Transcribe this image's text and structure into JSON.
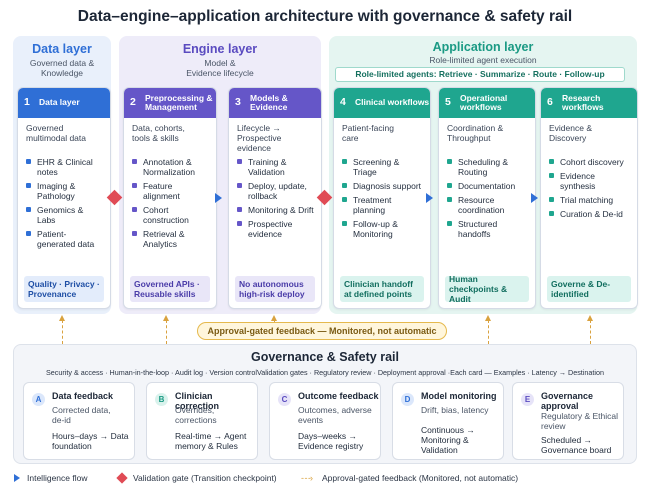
{
  "title": "Data–engine–application architecture with governance & safety rail",
  "colors": {
    "blue": "#2f6fd6",
    "purple": "#6556c8",
    "teal": "#1fa68f",
    "red": "#e04b55",
    "amber": "#d9a23f"
  },
  "layers": {
    "data": {
      "title": "Data layer",
      "subtitle": "Governed data &\nKnowledge"
    },
    "engine": {
      "title": "Engine layer",
      "subtitle": "Model &\nEvidence lifecycle"
    },
    "application": {
      "title": "Application layer",
      "subtitle": "Role-limited agent execution",
      "agents": "Role-limited agents: Retrieve · Summarize · Route · Follow-up"
    }
  },
  "cards": [
    {
      "num": "1",
      "title": "Data layer",
      "intro": "Governed\nmultimodal data",
      "bullets": [
        "EHR & Clinical notes",
        "Imaging & Pathology",
        "Genomics & Labs",
        "Patient-generated data"
      ],
      "footer": "Quality · Privacy · Provenance"
    },
    {
      "num": "2",
      "title": "Preprocessing & Management",
      "intro": "Data, cohorts,\ntools & skills",
      "bullets": [
        "Annotation & Normalization",
        "Feature alignment",
        "Cohort construction",
        "Retrieval & Analytics"
      ],
      "footer": "Governed APIs · Reusable skills"
    },
    {
      "num": "3",
      "title": "Models & Evidence",
      "intro": "Lifecycle →\nProspective\nevidence",
      "bullets": [
        "Training & Validation",
        "Deploy, update, rollback",
        "Monitoring & Drift",
        "Prospective evidence"
      ],
      "footer": "No autonomous high-risk deploy"
    },
    {
      "num": "4",
      "title": "Clinical workflows",
      "intro": "Patient-facing\ncare",
      "bullets": [
        "Screening & Triage",
        "Diagnosis support",
        "Treatment planning",
        "Follow-up & Monitoring"
      ],
      "footer": "Clinician handoff at defined points"
    },
    {
      "num": "5",
      "title": "Operational workflows",
      "intro": "Coordination &\nThroughput",
      "bullets": [
        "Scheduling & Routing",
        "Documentation",
        "Resource coordination",
        "Structured handoffs"
      ],
      "footer": "Human checkpoints & Audit"
    },
    {
      "num": "6",
      "title": "Research workflows",
      "intro": "Evidence &\nDiscovery",
      "bullets": [
        "Cohort discovery",
        "Evidence synthesis",
        "Trial matching",
        "Curation & De-id"
      ],
      "footer": "Governe & De-identified"
    }
  ],
  "feedback_pill": "Approval-gated feedback — Monitored, not automatic",
  "governance": {
    "title": "Governance & Safety rail",
    "strip": "Security & access · Human-in-the-loop · Audit log · Version controlValidation gates · Regulatory review · Deployment approval ·Each card — Examples · Latency → Destination",
    "cards": [
      {
        "letter": "A",
        "title": "Data feedback",
        "sub": "Corrected data,\nde-id",
        "line": "Hours–days → Data\nfoundation"
      },
      {
        "letter": "B",
        "title": "Clinician correction",
        "sub": "Overrides,\ncorrections",
        "line": "Real-time → Agent\nmemory & Rules"
      },
      {
        "letter": "C",
        "title": "Outcome feedback",
        "sub": "Outcomes, adverse\nevents",
        "line": "Days–weeks →\nEvidence registry"
      },
      {
        "letter": "D",
        "title": "Model monitoring",
        "sub": "Drift, bias, latency",
        "line": "Continuous →\nMonitoring &\nValidation"
      },
      {
        "letter": "E",
        "title": "Governance\napproval",
        "sub": "Regulatory & Ethical\nreview",
        "line": "Scheduled →\nGovernance board"
      }
    ]
  },
  "legend": {
    "flow": "Intelligence flow",
    "gate": "Validation gate (Transition checkpoint)",
    "feedback": "Approval-gated feedback (Monitored, not automatic)"
  }
}
